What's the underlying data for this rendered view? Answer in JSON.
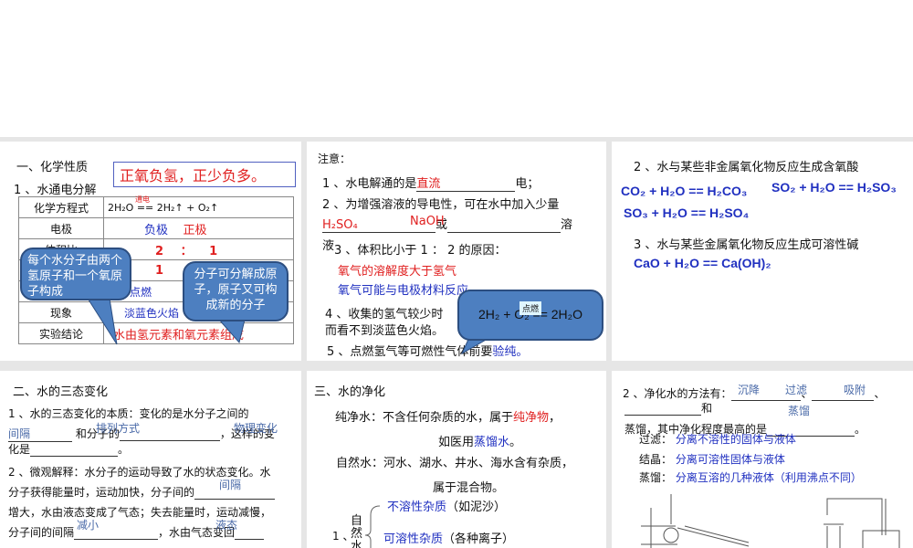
{
  "p1": {
    "section": "一、化学性质",
    "title": "1 、水通电分解",
    "boxed": "正氧负氢，正少负多。",
    "rows": [
      {
        "label": "化学方程式",
        "value": "2H₂O == 2H₂↑ + O₂↑",
        "cond": "通电"
      },
      {
        "label": "电极",
        "neg": "负极",
        "pos": "正极"
      },
      {
        "label": "体积比",
        "value": "2 ： 1"
      },
      {
        "label": "",
        "value": "1"
      },
      {
        "label": "",
        "value": "点燃"
      },
      {
        "label": "现象",
        "value": "淡蓝色火焰"
      },
      {
        "label": "实验结论",
        "value": "水由氢元素和氧元素组成"
      }
    ],
    "bubble_left": "每个水分子由两个氢原子和一个氧原子构成",
    "bubble_right": "分子可分解成原子，原子又可构成新的分子"
  },
  "p2": {
    "title": "注意：",
    "l1a": "1 、水电解通的是",
    "l1ans": "直流",
    "l1b": "电；",
    "l2": "2 、为增强溶液的导电性，可在水中加入少量",
    "ans1": "H₂SO₄",
    "ans2": "NaOH",
    "or": "或",
    "sol": "溶",
    "sol2": "液",
    "l3": "3 、体积比小于 1 ： 2 的原因：",
    "r1": "氧气的溶解度大于氢气",
    "r2": "氧气可能与电极材料反应",
    "l4a": "4 、收集的氢气较少时",
    "l4b": "而看不到淡蓝色火焰。",
    "l5a": "5 、点燃氢气等可燃性气体前要",
    "l5ans": "验纯。",
    "bubble_eq": "2H₂ + O₂ == 2H₂O",
    "bubble_cond": "点燃"
  },
  "p3": {
    "h2": "2 、水与某些非金属氧化物反应生成含氧酸",
    "eq1": "CO₂ + H₂O == H₂CO₃",
    "eq2": "SO₂ + H₂O == H₂SO₃",
    "eq3": "SO₃ + H₂O == H₂SO₄",
    "h3": "3 、水与某些金属氧化物反应生成可溶性碱",
    "eq4": "CaO + H₂O == Ca(OH)₂"
  },
  "p4": {
    "section": "二、水的三态变化",
    "l1": "1 、水的三态变化的本质：变化的是水分子之间的",
    "a1": "间隔",
    "and": "和分子的",
    "a2": "排列方式",
    "comma": "，这样的变",
    "l1c": "化是",
    "a3": "物理变化",
    "dot": "。",
    "l2": "2 、微观解释：水分子的运动导致了水的状态变化。水",
    "l3": "分子获得能量时，运动加快，分子间的",
    "a4": "间隔",
    "l4": "增大，水由液态变成了气态；失去能量时，运动减慢，",
    "l5": "分子间的间隔",
    "a5": "减小",
    "l5b": "，水由气态变回",
    "a6": "液态"
  },
  "p5": {
    "section": "三、水的净化",
    "pure": "纯净水：不含任何杂质的水，属于",
    "pure_ans": "纯净物",
    "pure_end": "，",
    "eg": "如医用",
    "eg_ans": "蒸馏水",
    "eg_end": "。",
    "nat": "自然水：河水、湖水、井水、海水含有杂质，",
    "nat2": "属于混合物。",
    "num": "1 、",
    "natw": "自然水",
    "insol": "不溶性杂质",
    "insol_eg": "（如泥沙）",
    "sol": "可溶性杂质",
    "sol_eg": "（各种离子）"
  },
  "p6": {
    "l1": "2 、净化水的方法有：",
    "m1": "沉降",
    "m2": "过滤",
    "m3": "吸附",
    "m4": "蒸馏",
    "and": "和",
    "l2": "蒸馏，其中净化程度最高的是",
    "f_label": "过滤：",
    "f": "分离不溶性的固体与液体",
    "c_label": "结晶：",
    "c": "分离可溶性固体与液体",
    "d_label": "蒸馏：",
    "d": "分离互溶的几种液体（利用沸点不同）"
  }
}
